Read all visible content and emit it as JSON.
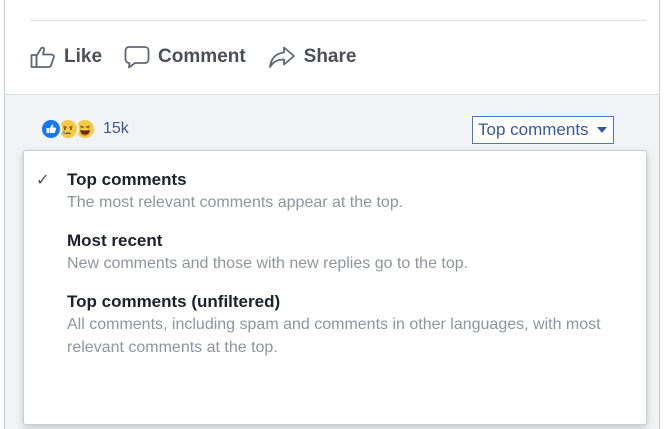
{
  "actions": {
    "like_label": "Like",
    "comment_label": "Comment",
    "share_label": "Share"
  },
  "reactions": {
    "icons": [
      "like-icon",
      "sad-icon",
      "haha-icon"
    ],
    "count": "15k",
    "colors": {
      "like": "#1877f2",
      "emoji": "#f7c948"
    }
  },
  "sort": {
    "selected": "Top comments",
    "options": [
      {
        "title": "Top comments",
        "description": "The most relevant comments appear at the top.",
        "checked": true
      },
      {
        "title": "Most recent",
        "description": "New comments and those with new replies go to the top.",
        "checked": false
      },
      {
        "title": "Top comments (unfiltered)",
        "description": "All comments, including spam and comments in other languages, with most relevant comments at the top.",
        "checked": false
      }
    ],
    "check_glyph": "✓"
  },
  "colors": {
    "link": "#385898",
    "muted": "#90949c",
    "action": "#4b4f56"
  }
}
